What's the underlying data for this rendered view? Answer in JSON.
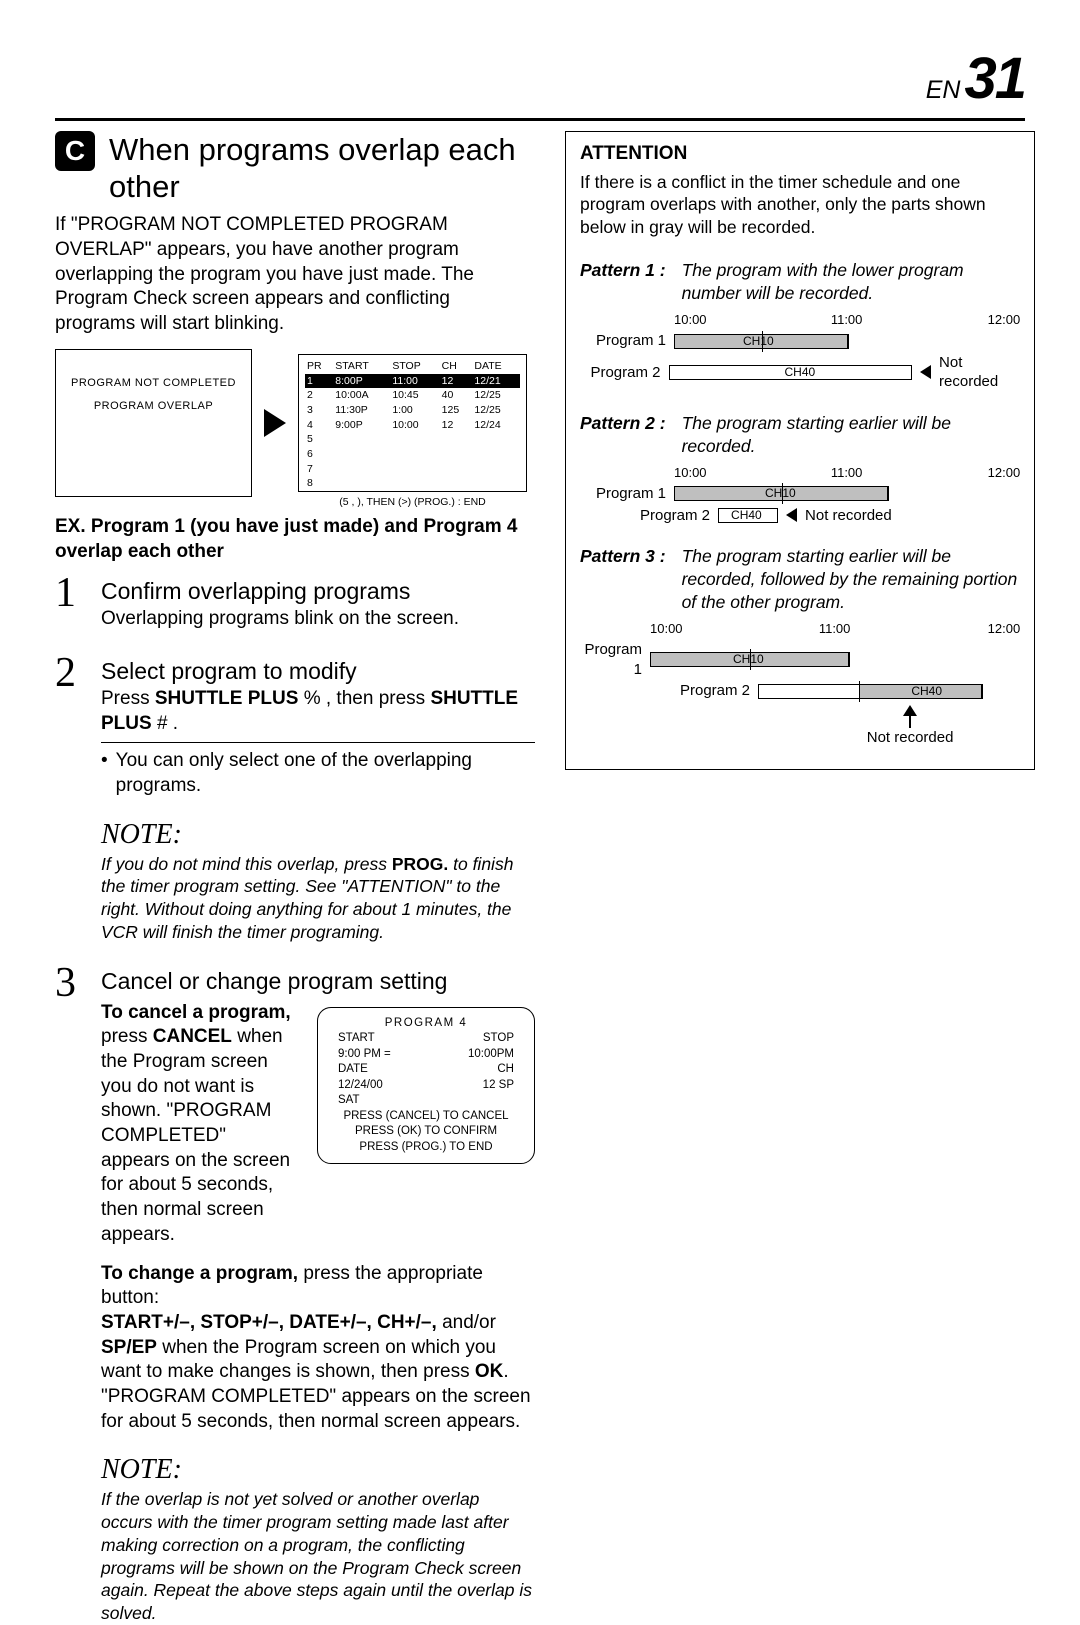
{
  "header": {
    "en": "EN",
    "page": "31"
  },
  "section": {
    "badge": "C",
    "title": "When programs overlap each other",
    "intro": "If \"PROGRAM NOT COMPLETED PROGRAM OVERLAP\" appears, you have another program overlapping the program you have just made. The Program Check screen appears and conflicting programs will start blinking."
  },
  "screen1": {
    "l1": "PROGRAM NOT COMPLETED",
    "l2": "PROGRAM OVERLAP"
  },
  "screen2": {
    "headers": [
      "PR",
      "START",
      "STOP",
      "CH",
      "DATE"
    ],
    "rows": [
      [
        "1",
        "8:00P",
        "11:00",
        "12",
        "12/21"
      ],
      [
        "2",
        "10:00A",
        "10:45",
        "40",
        "12/25"
      ],
      [
        "3",
        "11:30P",
        "1:00",
        "125",
        "12/25"
      ],
      [
        "4",
        "9:00P",
        "10:00",
        "12",
        "12/24"
      ],
      [
        "5",
        "",
        "",
        "",
        ""
      ],
      [
        "6",
        "",
        "",
        "",
        ""
      ],
      [
        "7",
        "",
        "",
        "",
        ""
      ],
      [
        "8",
        "",
        "",
        "",
        ""
      ]
    ],
    "footer": "(5 ,   ), THEN (>)   (PROG.) : END"
  },
  "example": "EX. Program 1 (you have just made) and Program 4 overlap each other",
  "steps": {
    "s1": {
      "n": "1",
      "title": "Confirm overlapping programs",
      "text": "Overlapping programs blink on the screen."
    },
    "s2": {
      "n": "2",
      "title": "Select program to modify",
      "text_a": "Press ",
      "btn1": "SHUTTLE PLUS",
      "sym1": " %   , then press ",
      "btn2": "SHUTTLE PLUS",
      "sym2": " # .",
      "bullet": "You can only select one of the overlapping programs."
    },
    "s3": {
      "n": "3",
      "title": "Cancel or change program setting"
    }
  },
  "note1": {
    "head": "NOTE:",
    "text_a": "If you do not mind this overlap, press ",
    "btn": "PROG.",
    "text_b": " to finish the timer program setting. See \"ATTENTION\" to the right. Without doing anything for about 1 minutes, the VCR will finish the timer programing."
  },
  "cancel": {
    "head": "To cancel a program,",
    "text_a": "press ",
    "btn": "CANCEL",
    "text_b": " when the Program screen you do not want is shown. \"PROGRAM COMPLETED\" appears on the screen for about 5 seconds, then normal screen appears."
  },
  "screen3": {
    "title": "PROGRAM 4",
    "r1a": "START",
    "r1b": "STOP",
    "r2a": "9:00 PM   =",
    "r2b": "10:00PM",
    "r3a": "DATE",
    "r3b": "CH",
    "r4a": "12/24/00",
    "r4b": "12   SP",
    "r5": "SAT",
    "f1": "PRESS (CANCEL) TO CANCEL",
    "f2": "PRESS (OK) TO CONFIRM",
    "f3": "PRESS (PROG.) TO END"
  },
  "change": {
    "head": "To change a program,",
    "tail": " press the appropriate button:",
    "btns": "START+/–, STOP+/–, DATE+/–, CH+/–, ",
    "andor": "and/or ",
    "spep": "SP/EP",
    "rest1": " when the Program screen on which you want to make changes is shown, then press ",
    "ok": "OK",
    "rest2": ".",
    "after": "\"PROGRAM COMPLETED\" appears on the screen for about 5 seconds, then normal screen appears."
  },
  "note2": {
    "head": "NOTE:",
    "text": "If the overlap is not yet solved or another overlap occurs with the timer program setting made last after making correction on a program, the conflicting programs will be shown on the Program Check screen again. Repeat the above steps again until the overlap is solved."
  },
  "attention": {
    "head": "ATTENTION",
    "intro": "If there is a conflict in the timer schedule and one program overlaps with another, only the parts shown below in gray will be recorded.",
    "times": [
      "10:00",
      "11:00",
      "12:00"
    ],
    "p1": {
      "label": "Pattern 1 :",
      "desc": "The program with the lower program number will be recorded.",
      "r1": "Program 1",
      "c1": "CH10",
      "r2": "Program 2",
      "c2": "CH40",
      "nr": "Not recorded"
    },
    "p2": {
      "label": "Pattern 2 :",
      "desc": "The program starting earlier will be recorded.",
      "r1": "Program 1",
      "c1": "CH10",
      "r2": "Program 2",
      "c2": "CH40",
      "nr": "Not recorded"
    },
    "p3": {
      "label": "Pattern 3 :",
      "desc": "The program starting earlier will be recorded, followed by the remaining portion of the other program.",
      "r1": "Program 1",
      "c1": "CH10",
      "r2": "Program 2",
      "c2": "CH40",
      "nr": "Not recorded"
    }
  }
}
